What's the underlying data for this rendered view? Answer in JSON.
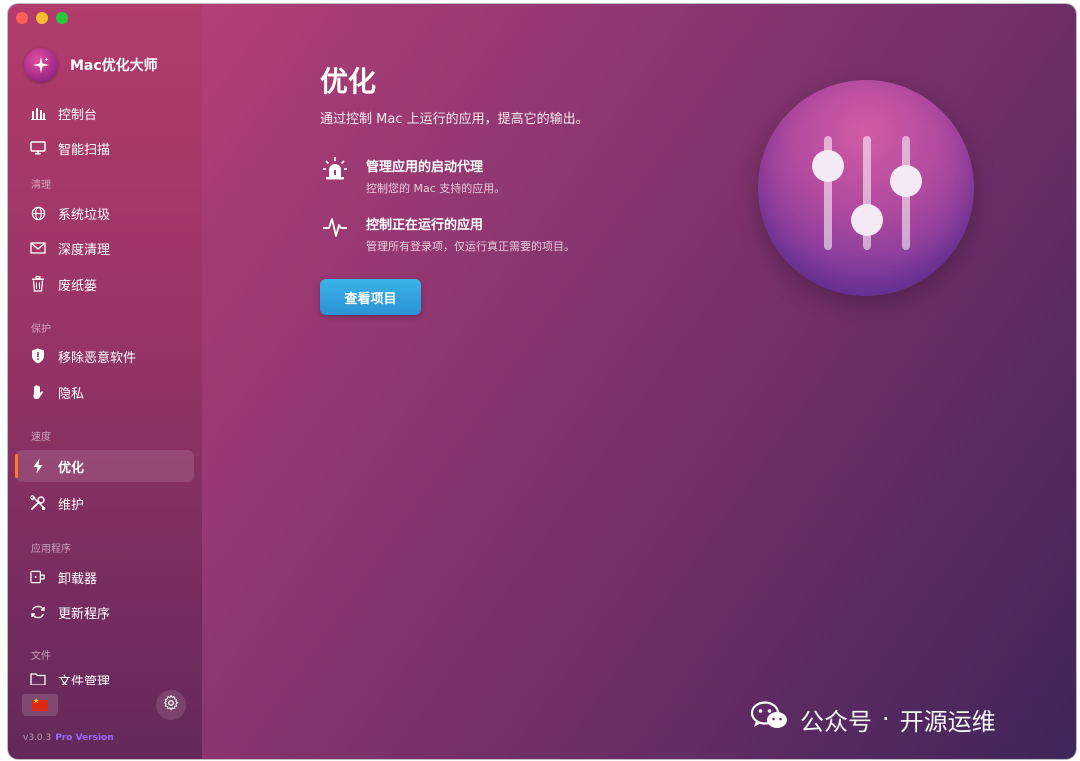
{
  "app": {
    "name": "Mac优化大师"
  },
  "sidebar": {
    "items": [
      {
        "label": "控制台"
      },
      {
        "label": "智能扫描"
      },
      {
        "label": "系统垃圾"
      },
      {
        "label": "深度清理"
      },
      {
        "label": "废纸篓"
      },
      {
        "label": "移除恶意软件"
      },
      {
        "label": "隐私"
      },
      {
        "label": "优化"
      },
      {
        "label": "维护"
      },
      {
        "label": "卸载器"
      },
      {
        "label": "更新程序"
      },
      {
        "label": "文件管理"
      }
    ],
    "sections": [
      "清理",
      "保护",
      "速度",
      "应用程序",
      "文件"
    ],
    "active_index": 7,
    "version": "v3.0.3",
    "edition": "Pro Version"
  },
  "main": {
    "title": "优化",
    "subtitle": "通过控制 Mac 上运行的应用，提高它的输出。",
    "features": [
      {
        "title": "管理应用的启动代理",
        "desc": "控制您的 Mac 支持的应用。",
        "icon": "siren-icon"
      },
      {
        "title": "控制正在运行的应用",
        "desc": "管理所有登录项，仅运行真正需要的项目。",
        "icon": "pulse-icon"
      }
    ],
    "button": "查看项目"
  },
  "watermark": {
    "prefix": "公众号",
    "dot": "·",
    "name": "开源运维"
  },
  "colors": {
    "accent": "#ff7a2f",
    "button": "#2a93d6",
    "pro": "#9b6bff"
  }
}
